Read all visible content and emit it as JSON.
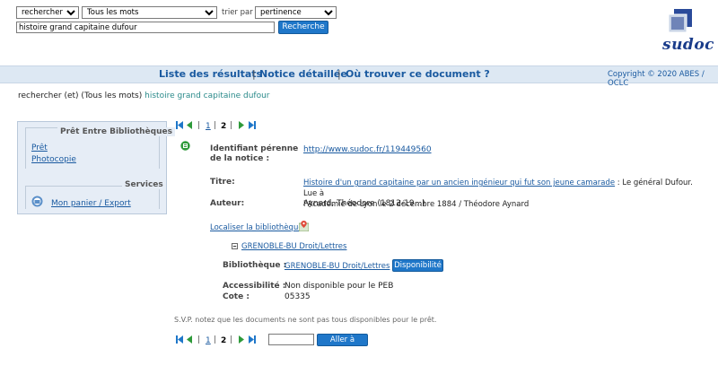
{
  "search": {
    "operator": "rechercher (et)",
    "field": "Tous les mots",
    "sort_label": "trier par",
    "sort_value": "pertinence",
    "query": "histoire grand capitaine dufour",
    "button": "Recherche"
  },
  "logo": {
    "text": "sudoc"
  },
  "nav": {
    "results": "Liste des résultats",
    "detail": "Notice détaillée",
    "where": "Où trouver ce document ?",
    "sep": "|",
    "copyright": "Copyright © 2020 ABES / OCLC"
  },
  "recap": {
    "prefix": "rechercher (et) (Tous les mots)",
    "query": "histoire grand capitaine dufour"
  },
  "sidebar": {
    "peb_title": "Prêt Entre Bibliothèques",
    "pret": "Prêt",
    "photocopie": "Photocopie",
    "services_title": "Services",
    "panier": "Mon panier / Export"
  },
  "pager": {
    "sep": "|",
    "page1": "1",
    "page2": "2",
    "goto_button": "Aller à"
  },
  "record": {
    "id_label_1": "Identifiant pérenne",
    "id_label_2": "de la notice :",
    "id_value": "http://www.sudoc.fr/119449560",
    "title_label": "Titre:",
    "title_link": "Histoire d'un grand capitaine par un ancien ingénieur qui fut son jeune camarade",
    "title_rest_1": " : Le général Dufour. Lue à",
    "title_rest_2": "l'Académie de Lyon le 2 décembre 1884 / Théodore Aynard",
    "author_label": "Auteur:",
    "author_value": "Aynard, Théodore (1812-19...)",
    "localiser": "Localiser la bibliothèque",
    "library_toggle": "GRENOBLE-BU Droit/Lettres",
    "bib_label": "Bibliothèque :",
    "bib_value": "GRENOBLE-BU Droit/Lettres",
    "dispo_button": "Disponibilité",
    "access_label": "Accessibilité :",
    "access_value": "Non disponible pour le PEB",
    "cote_label": "Cote :",
    "cote_value": "05335"
  },
  "note": "S.V.P. notez que les documents ne sont pas tous disponibles pour le prêt.",
  "colors": {
    "accent": "#1f77c9",
    "link": "#1a5aa0",
    "navbar": "#dde8f3",
    "sidebar": "#e6edf6",
    "status_green": "#2e9a3a"
  }
}
